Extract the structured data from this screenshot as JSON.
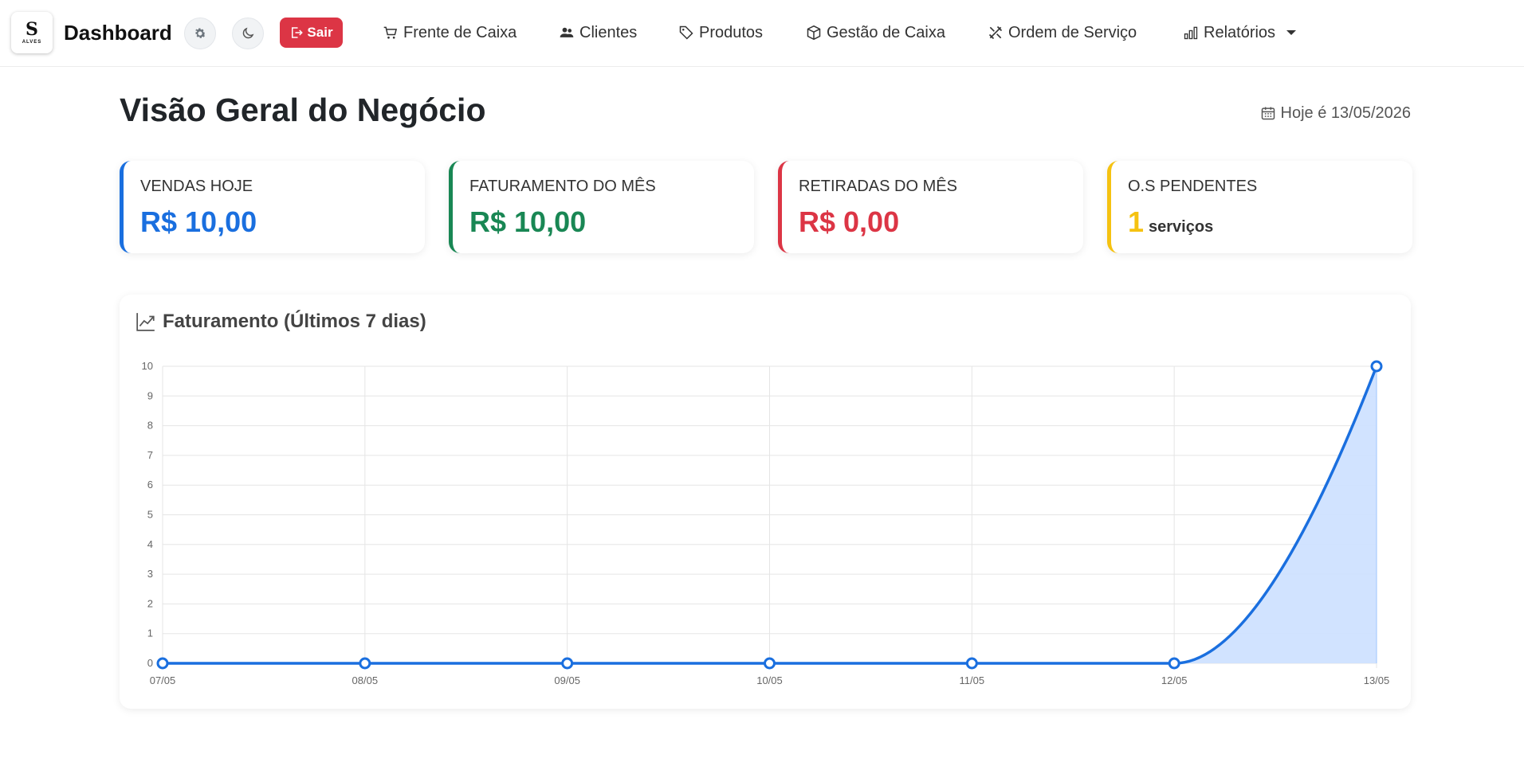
{
  "brand": {
    "logo_mark": "S",
    "logo_text": "ALVES",
    "title": "Dashboard"
  },
  "header": {
    "logout_label": "Sair"
  },
  "nav": {
    "items": [
      {
        "label": "Frente de Caixa",
        "icon": "cart-icon"
      },
      {
        "label": "Clientes",
        "icon": "users-icon"
      },
      {
        "label": "Produtos",
        "icon": "tag-icon"
      },
      {
        "label": "Gestão de Caixa",
        "icon": "box-icon"
      },
      {
        "label": "Ordem de Serviço",
        "icon": "tools-icon"
      },
      {
        "label": "Relatórios",
        "icon": "bar-chart-icon"
      }
    ]
  },
  "main": {
    "title": "Visão Geral do Negócio",
    "date": "Hoje é 13/05/2026"
  },
  "cards": [
    {
      "label": "VENDAS HOJE",
      "value": "R$ 10,00",
      "color": "#1a6fdf"
    },
    {
      "label": "FATURAMENTO DO MÊS",
      "value": "R$ 10,00",
      "color": "#198754"
    },
    {
      "label": "RETIRADAS DO MÊS",
      "value": "R$ 0,00",
      "color": "#dc3545"
    },
    {
      "label": "O.S PENDENTES",
      "value": "1",
      "unit": "serviços",
      "color": "#f5c211"
    }
  ],
  "chart_data": {
    "type": "area",
    "title": "Faturamento (Últimos 7 dias)",
    "categories": [
      "07/05",
      "08/05",
      "09/05",
      "10/05",
      "11/05",
      "12/05",
      "13/05"
    ],
    "values": [
      0,
      0,
      0,
      0,
      0,
      0,
      10
    ],
    "ylim": [
      0,
      10
    ],
    "yticks": [
      0,
      1,
      2,
      3,
      4,
      5,
      6,
      7,
      8,
      9,
      10
    ],
    "grid": true,
    "line_color": "#1a6fdf",
    "fill_color": "#cfe2ff"
  }
}
